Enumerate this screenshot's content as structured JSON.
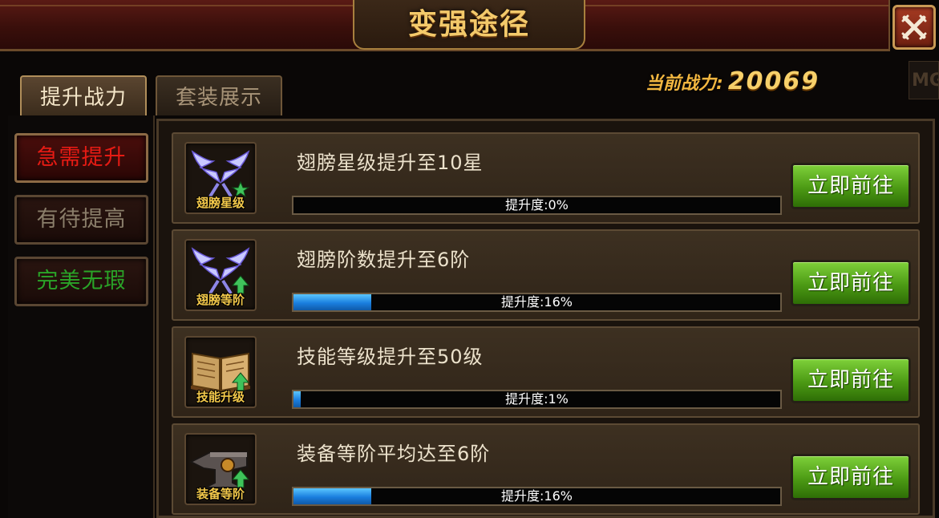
{
  "title": "变强途径",
  "tabs": [
    {
      "label": "提升战力",
      "active": true
    },
    {
      "label": "套装展示",
      "active": false
    }
  ],
  "combat_power": {
    "label": "当前战力:",
    "value": "20069"
  },
  "corner_badge": "MG",
  "categories": [
    {
      "label": "急需提升",
      "color": "#e61b14"
    },
    {
      "label": "有待提高",
      "color": "#8a7e6a"
    },
    {
      "label": "完美无瑕",
      "color": "#2aa428"
    }
  ],
  "tasks": [
    {
      "icon_name": "wings-icon",
      "icon_label": "翅膀星级",
      "title": "翅膀星级提升至10星",
      "progress": 0,
      "progress_text": "提升度:0%",
      "button": "立即前往"
    },
    {
      "icon_name": "wings-icon",
      "icon_label": "翅膀等阶",
      "title": "翅膀阶数提升至6阶",
      "progress": 16,
      "progress_text": "提升度:16%",
      "button": "立即前往"
    },
    {
      "icon_name": "skill-book-icon",
      "icon_label": "技能升级",
      "title": "技能等级提升至50级",
      "progress": 1,
      "progress_text": "提升度:1%",
      "button": "立即前往"
    },
    {
      "icon_name": "anvil-icon",
      "icon_label": "装备等阶",
      "title": "装备等阶平均达至6阶",
      "progress": 16,
      "progress_text": "提升度:16%",
      "button": "立即前往"
    }
  ]
}
